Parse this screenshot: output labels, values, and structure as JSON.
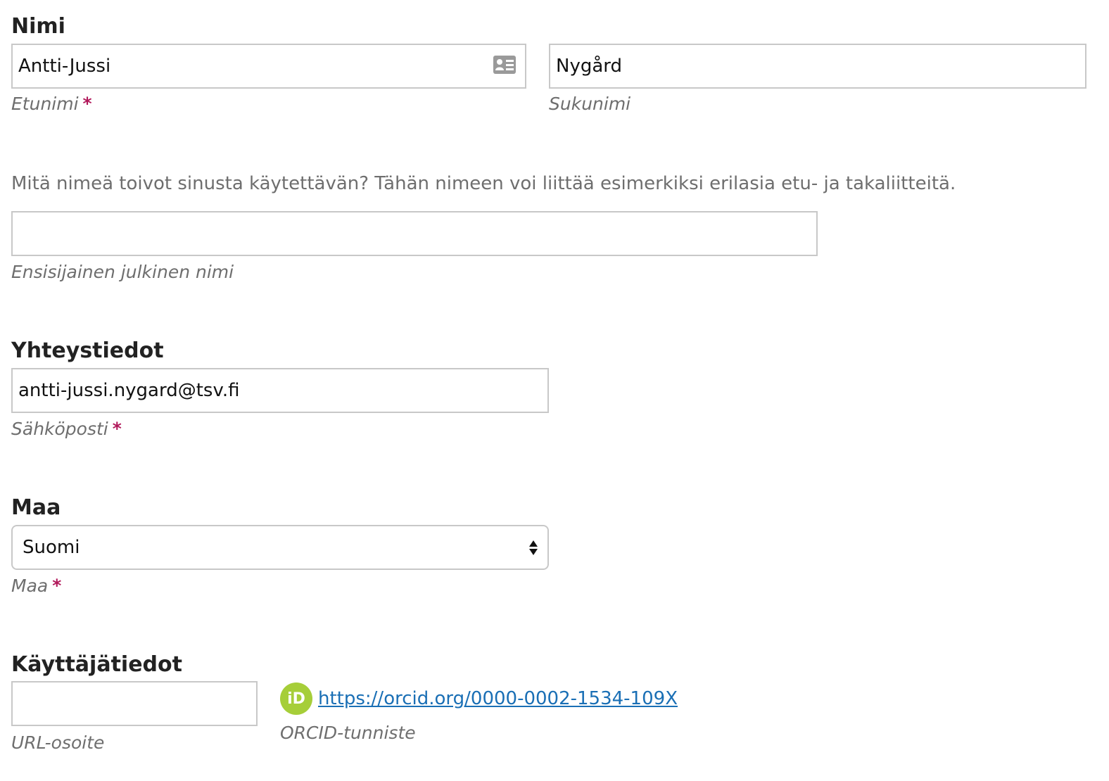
{
  "name_section": {
    "heading": "Nimi",
    "first_name": {
      "value": "Antti-Jussi",
      "hint": "Etunimi",
      "required": "*"
    },
    "last_name": {
      "value": "Nygård",
      "hint": "Sukunimi"
    },
    "preferred_description": "Mitä nimeä toivot sinusta käytettävän? Tähän nimeen voi liittää esimerkiksi erilasia etu- ja takaliitteitä.",
    "preferred_name": {
      "value": "",
      "hint": "Ensisijainen julkinen nimi"
    }
  },
  "contact_section": {
    "heading": "Yhteystiedot",
    "email": {
      "value": "antti-jussi.nygard@tsv.fi",
      "hint": "Sähköposti",
      "required": "*"
    }
  },
  "country_section": {
    "heading": "Maa",
    "country": {
      "selected": "Suomi",
      "hint": "Maa",
      "required": "*"
    }
  },
  "user_section": {
    "heading": "Käyttäjätiedot",
    "url": {
      "value": "",
      "hint": "URL-osoite"
    },
    "orcid": {
      "badge": "iD",
      "link": "https://orcid.org/0000-0002-1534-109X",
      "hint": "ORCID-tunniste"
    }
  },
  "colors": {
    "required": "#b1185a",
    "link": "#1a6fb5",
    "orcid_badge": "#a6ce39",
    "hint_text": "#6e6e6e",
    "border": "#c8c8c8"
  },
  "icons": {
    "first_name_autofill": "contact-card-icon",
    "select_arrows": "sort-arrows-icon",
    "orcid": "orcid-icon"
  }
}
